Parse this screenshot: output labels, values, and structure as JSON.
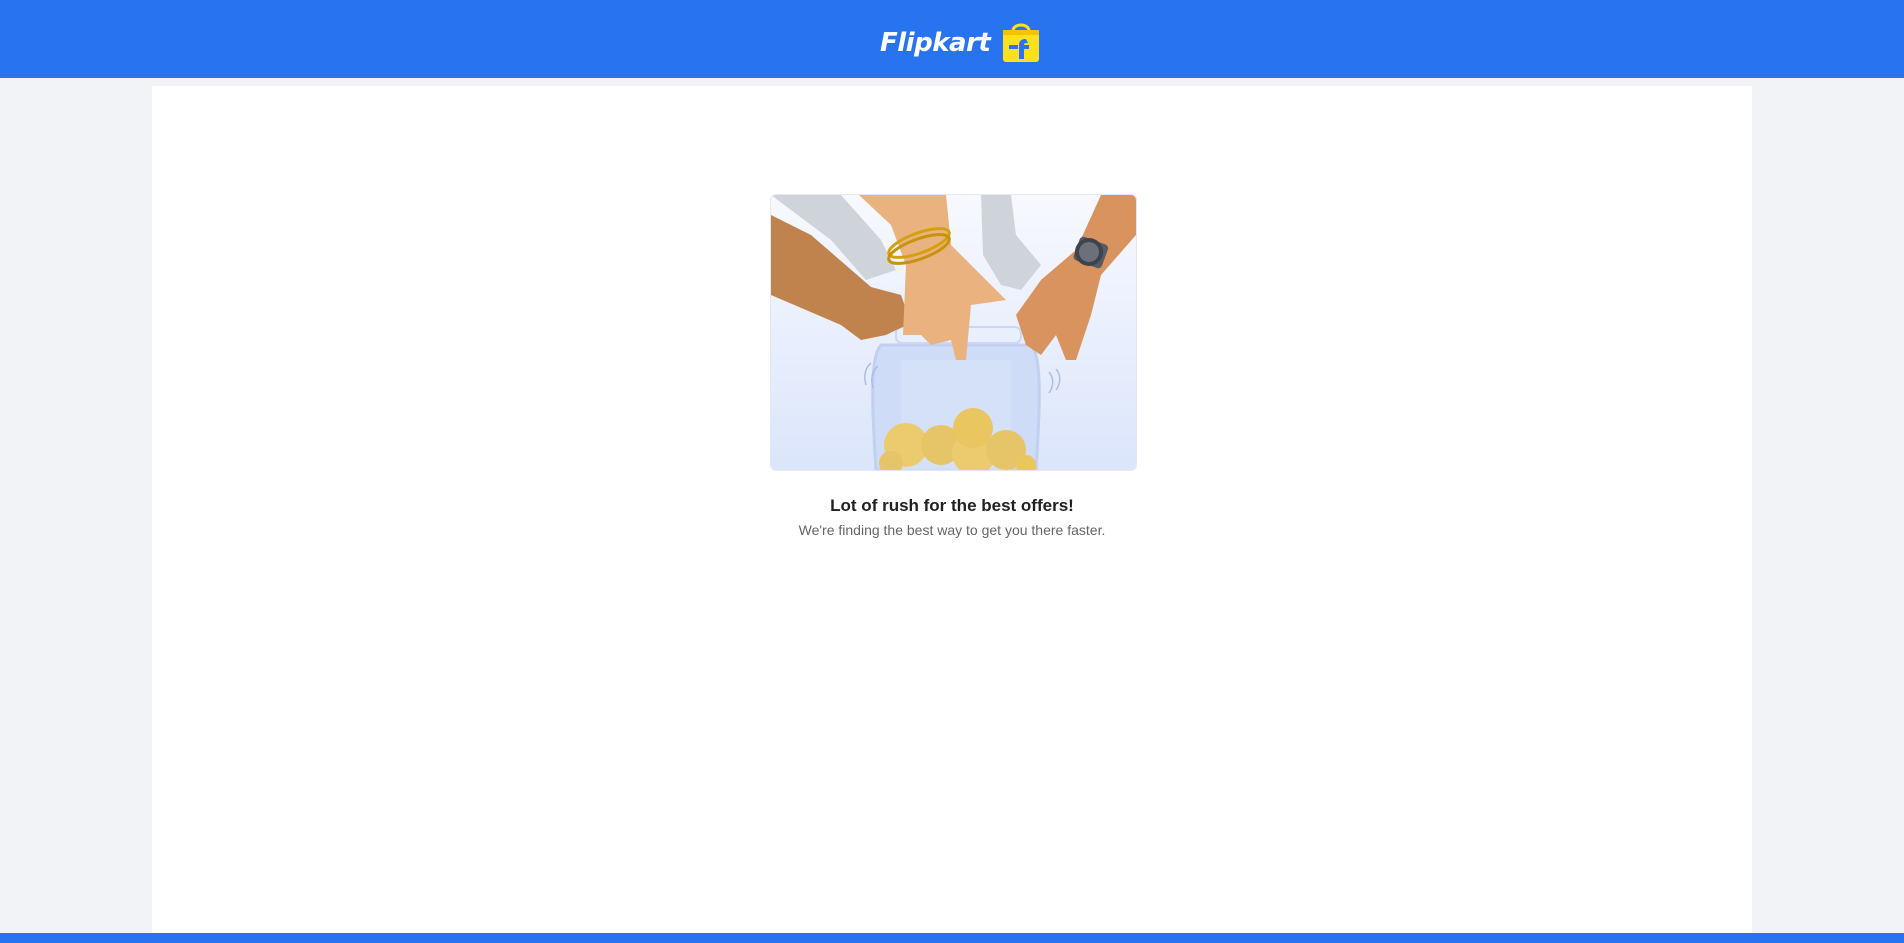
{
  "header": {
    "logo_text": "Flipkart",
    "logo_icon": "flipkart-bag-icon",
    "background_color": "#2874f0"
  },
  "main": {
    "illustration": "hands-reaching-into-cookie-jar-illustration",
    "title": "Lot of rush for the best offers!",
    "subtitle": "We're finding the best way to get you there faster."
  },
  "colors": {
    "brand_blue": "#2874f0",
    "page_background": "#f1f3f6",
    "card_background": "#ffffff",
    "title_text": "#212121",
    "subtitle_text": "#666666"
  }
}
